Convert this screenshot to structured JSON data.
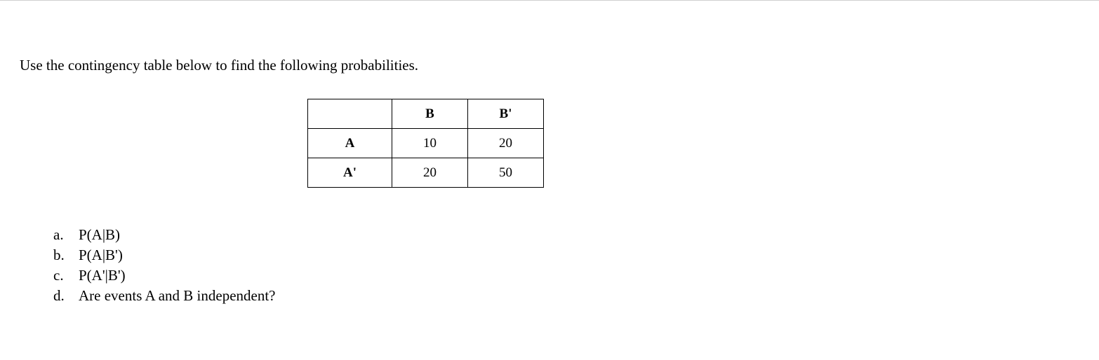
{
  "instruction": "Use the contingency table below to find the following probabilities.",
  "table": {
    "headers": {
      "col1": "B",
      "col2": "B'"
    },
    "rows": [
      {
        "label": "A",
        "c1": "10",
        "c2": "20"
      },
      {
        "label": "A'",
        "c1": "20",
        "c2": "50"
      }
    ]
  },
  "questions": [
    {
      "marker": "a.",
      "text": "P(A|B)"
    },
    {
      "marker": "b.",
      "text": "P(A|B')"
    },
    {
      "marker": "c.",
      "text": "P(A'|B')"
    },
    {
      "marker": "d.",
      "text": "Are events A and B independent?"
    }
  ],
  "chart_data": {
    "type": "table",
    "title": "Contingency table",
    "row_labels": [
      "A",
      "A'"
    ],
    "col_labels": [
      "B",
      "B'"
    ],
    "values": [
      [
        10,
        20
      ],
      [
        20,
        50
      ]
    ]
  }
}
